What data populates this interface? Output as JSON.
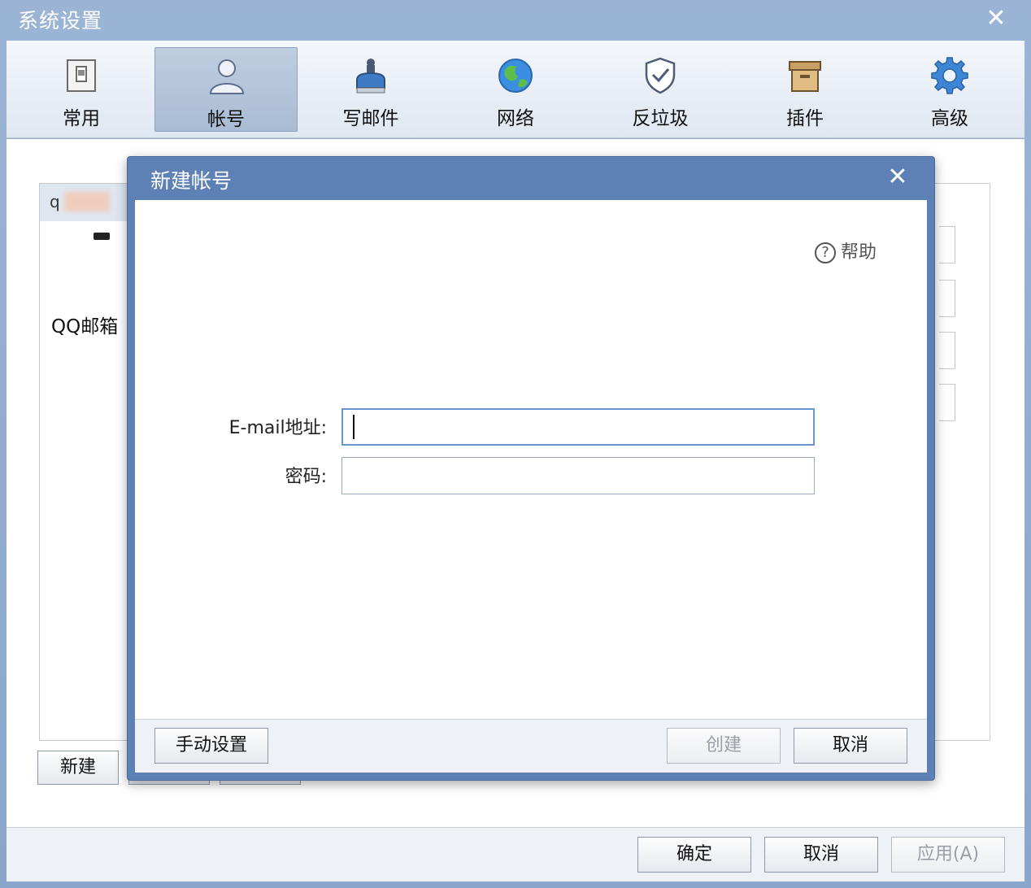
{
  "window": {
    "title": "系统设置",
    "close_glyph": "✕"
  },
  "toolbar": {
    "items": [
      {
        "label": "常用",
        "icon": "switch-icon"
      },
      {
        "label": "帐号",
        "icon": "user-icon",
        "active": true
      },
      {
        "label": "写邮件",
        "icon": "stamp-icon"
      },
      {
        "label": "网络",
        "icon": "globe-icon"
      },
      {
        "label": "反垃圾",
        "icon": "shield-check-icon"
      },
      {
        "label": "插件",
        "icon": "box-icon"
      },
      {
        "label": "高级",
        "icon": "gear-icon"
      }
    ]
  },
  "accounts": {
    "selected_prefix": "q",
    "list_label": "QQ邮箱",
    "new_button": "新建"
  },
  "footer": {
    "ok": "确定",
    "cancel": "取消",
    "apply": "应用(A)"
  },
  "dialog": {
    "title": "新建帐号",
    "close_glyph": "✕",
    "help": "帮助",
    "help_glyph": "?",
    "email_label": "E-mail地址:",
    "email_value": "",
    "password_label": "密码:",
    "password_value": "",
    "manual_button": "手动设置",
    "create_button": "创建",
    "cancel_button": "取消"
  },
  "colors": {
    "title_bar": "#8fa9cc",
    "dialog_frame": "#5e81b5",
    "focus_border": "#6a94cf"
  }
}
